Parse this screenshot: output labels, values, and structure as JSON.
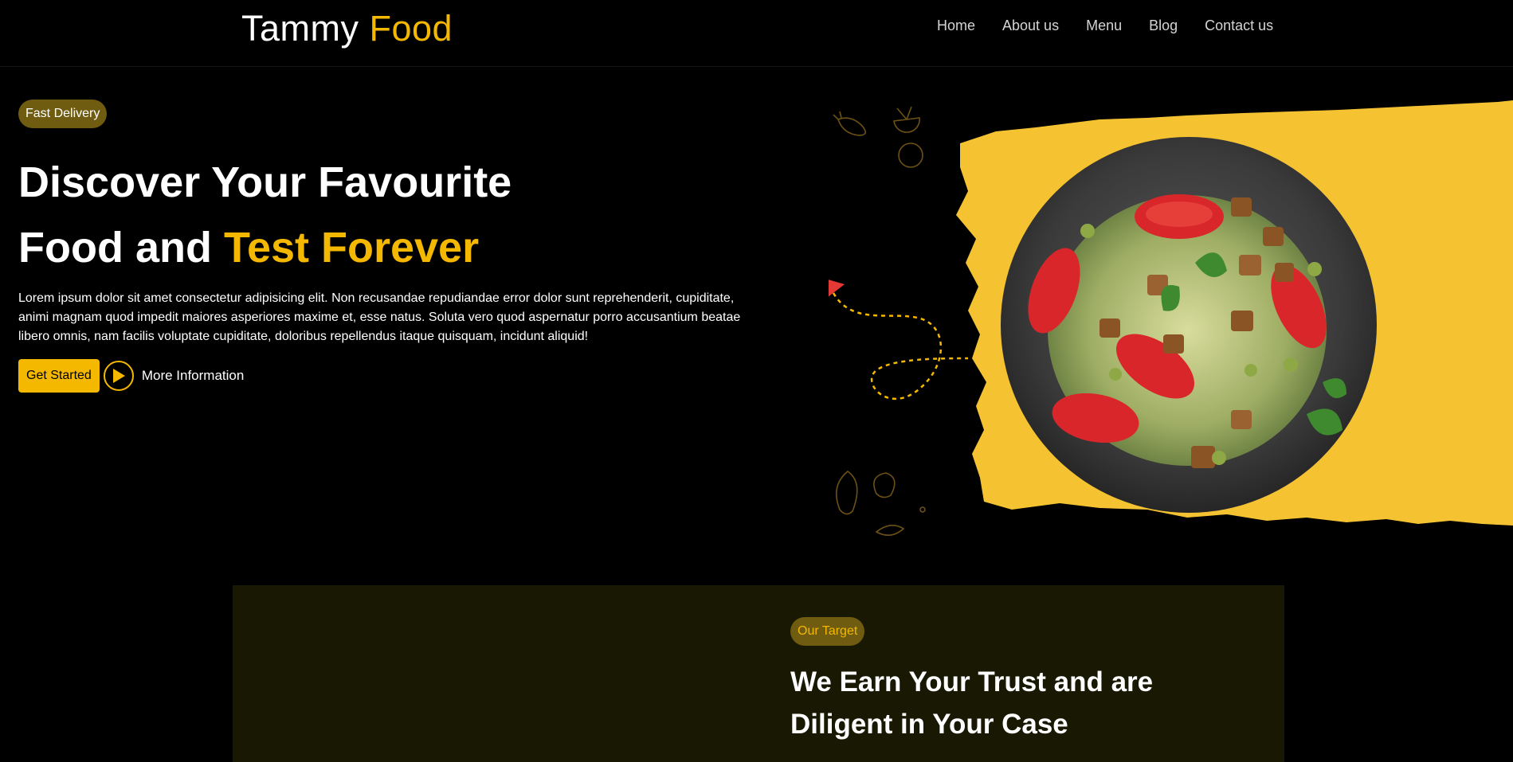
{
  "brand": {
    "name_main": "Tammy",
    "name_accent": "Food"
  },
  "nav": {
    "items": [
      {
        "label": "Home"
      },
      {
        "label": "About us"
      },
      {
        "label": "Menu"
      },
      {
        "label": "Blog"
      },
      {
        "label": "Contact us"
      }
    ]
  },
  "hero": {
    "badge": "Fast Delivery",
    "title_line1": "Discover Your Favourite",
    "title_line2_plain": "Food and",
    "title_line2_accent": "Test Forever",
    "description": "Lorem ipsum dolor sit amet consectetur adipisicing elit. Non recusandae repudiandae error dolor sunt reprehenderit, cupiditate, animi magnam quod impedit maiores asperiores maxime et, esse natus. Soluta vero quod aspernatur porro accusantium beatae libero omnis, nam facilis voluptate cupiditate, doloribus repellendus itaque quisquam, incidunt aliquid!",
    "cta_primary": "Get Started",
    "cta_secondary": "More Information",
    "play_icon": "play-icon",
    "image_icon": "salad-plate-icon"
  },
  "target": {
    "badge": "Our Target",
    "title_line1": "We Earn Your Trust and are",
    "title_line2": "Diligent in Your Case"
  },
  "colors": {
    "accent": "#f5b800",
    "background": "#000000",
    "badge_bg": "#6f5c11",
    "section_bg": "#181803",
    "arrow_red": "#e53935"
  }
}
